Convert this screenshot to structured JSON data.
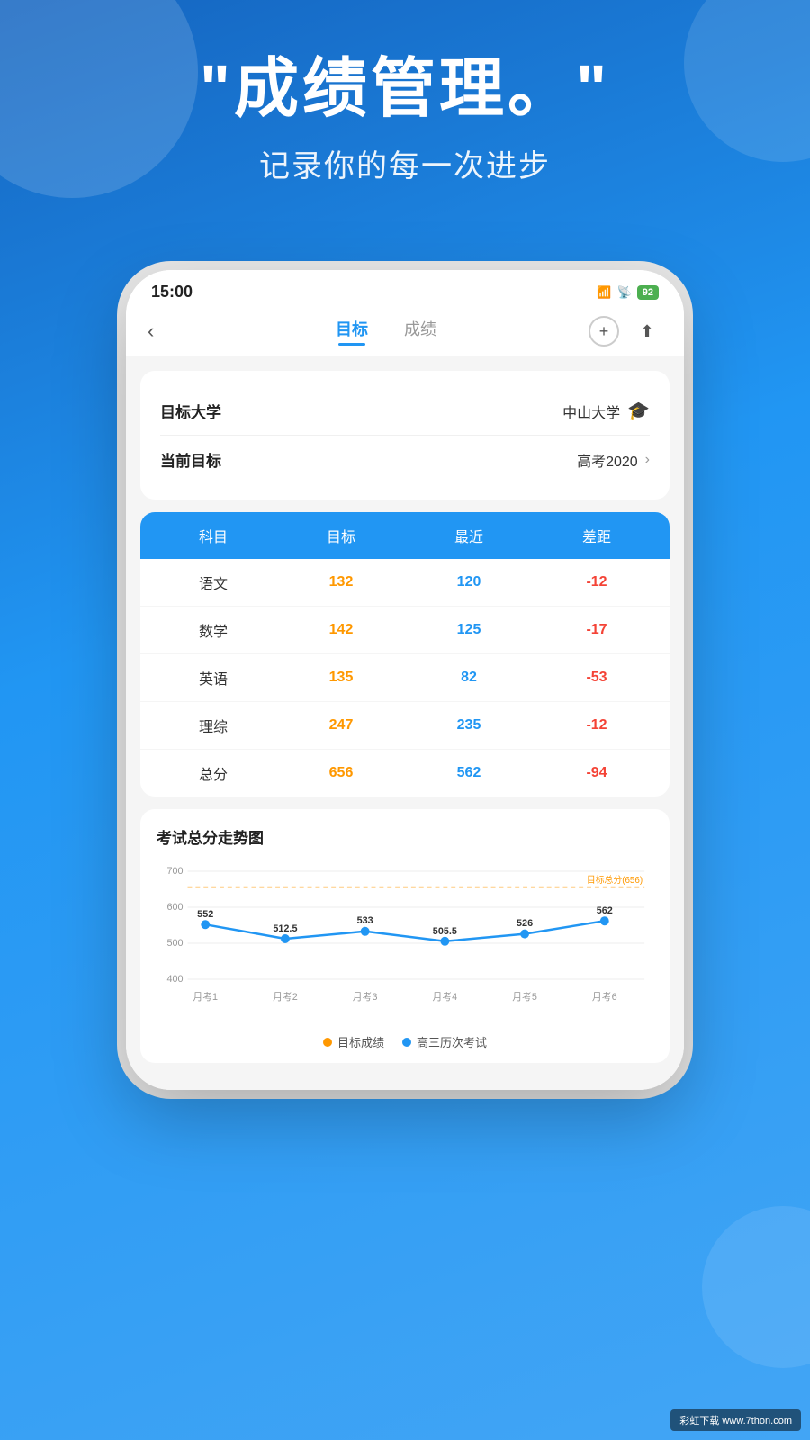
{
  "background": {
    "color": "#2196F3"
  },
  "header": {
    "title_main": "\"成绩管理。\"",
    "title_sub": "记录你的每一次进步"
  },
  "status_bar": {
    "time": "15:00",
    "battery": "92",
    "signal": "HD"
  },
  "nav": {
    "back_icon": "‹",
    "tab_active": "目标",
    "tab_inactive": "成绩",
    "add_icon": "+",
    "share_icon": "⬆"
  },
  "info_section": {
    "university_label": "目标大学",
    "university_value": "中山大学",
    "goal_label": "当前目标",
    "goal_value": "高考2020"
  },
  "table": {
    "headers": [
      "科目",
      "目标",
      "最近",
      "差距"
    ],
    "rows": [
      {
        "subject": "语文",
        "target": "132",
        "recent": "120",
        "diff": "-12"
      },
      {
        "subject": "数学",
        "target": "142",
        "recent": "125",
        "diff": "-17"
      },
      {
        "subject": "英语",
        "target": "135",
        "recent": "82",
        "diff": "-53"
      },
      {
        "subject": "理综",
        "target": "247",
        "recent": "235",
        "diff": "-12"
      },
      {
        "subject": "总分",
        "target": "656",
        "recent": "562",
        "diff": "-94"
      }
    ]
  },
  "chart": {
    "title": "考试总分走势图",
    "target_label": "目标总分(656)",
    "target_value": 656,
    "y_labels": [
      "700",
      "600",
      "500",
      "400"
    ],
    "x_labels": [
      "月考1",
      "月考2",
      "月考3",
      "月考4",
      "月考5",
      "月考6"
    ],
    "data_points": [
      552,
      512.5,
      533,
      505.5,
      526,
      562
    ],
    "legend": {
      "target": "目标成绩",
      "history": "高三历次考试"
    }
  },
  "watermark": {
    "text": "彩虹下载 www.7thon.com"
  }
}
